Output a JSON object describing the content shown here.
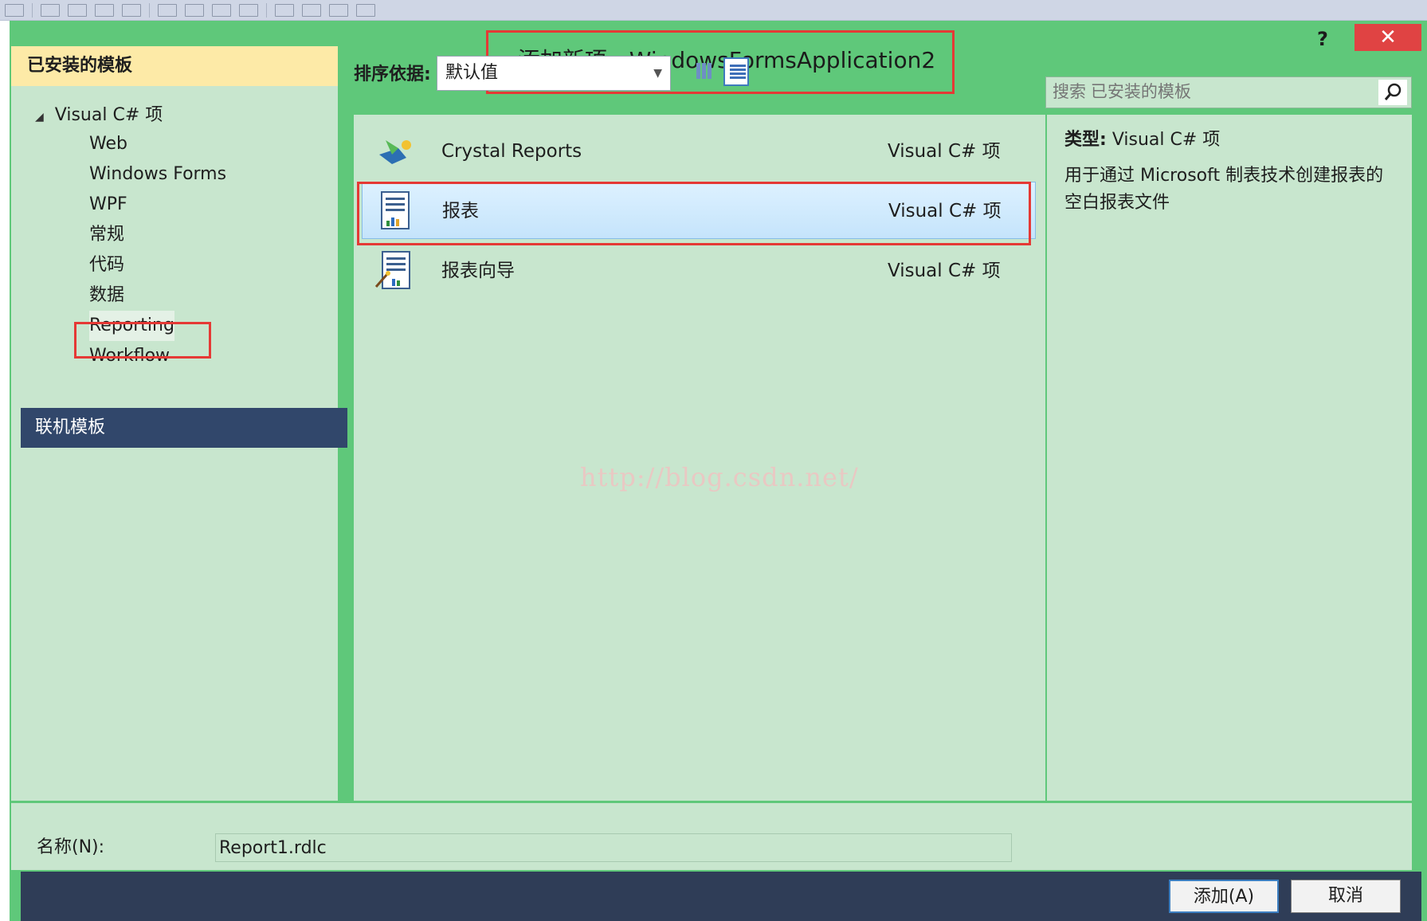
{
  "dialog": {
    "title": "添加新项 - WindowsFormsApplication2",
    "help_label": "?",
    "close_label": "✕",
    "accent_color": "#5fc87a",
    "highlight_color": "#e53935"
  },
  "left_panel": {
    "header": "已安装的模板",
    "tree": {
      "root_label": "Visual C# 项",
      "children": [
        "Web",
        "Windows Forms",
        "WPF",
        "常规",
        "代码",
        "数据",
        "Reporting",
        "Workflow"
      ]
    },
    "online_templates": "联机模板"
  },
  "toolbar": {
    "sort_label": "排序依据:",
    "sort_value": "默认值"
  },
  "items": [
    {
      "name": "Crystal Reports",
      "category": "Visual C# 项",
      "icon": "crystal-reports-icon"
    },
    {
      "name": "报表",
      "category": "Visual C# 项",
      "icon": "report-icon",
      "selected": true
    },
    {
      "name": "报表向导",
      "category": "Visual C# 项",
      "icon": "report-wizard-icon"
    }
  ],
  "search": {
    "placeholder": "搜索 已安装的模板"
  },
  "details": {
    "type_label": "类型:",
    "type_value": "Visual C# 项",
    "description": "用于通过 Microsoft 制表技术创建报表的空白报表文件"
  },
  "name_row": {
    "label": "名称(N):",
    "value": "Report1.rdlc"
  },
  "buttons": {
    "add": "添加(A)",
    "cancel": "取消"
  },
  "watermark": "http://blog.csdn.net/"
}
